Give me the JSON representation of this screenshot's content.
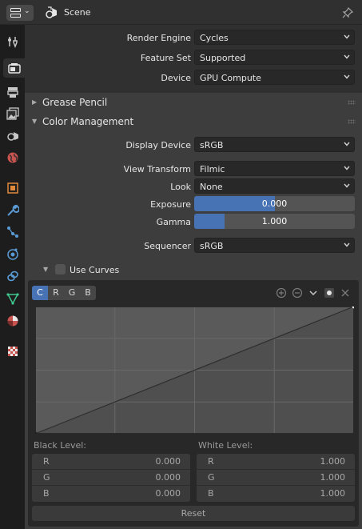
{
  "header": {
    "context_label": "Scene",
    "editor_type_icon": "properties-editor-icon",
    "scene_icon": "scene-icon",
    "pin_icon": "pin-icon"
  },
  "tabs": [
    {
      "name": "tool",
      "icon": "tool-icon"
    },
    {
      "name": "render",
      "icon": "camera-render-icon",
      "active": true
    },
    {
      "name": "output",
      "icon": "printer-output-icon"
    },
    {
      "name": "view-layer",
      "icon": "image-layers-icon"
    },
    {
      "name": "scene",
      "icon": "scene-icon"
    },
    {
      "name": "world",
      "icon": "world-icon"
    },
    {
      "name": "object",
      "icon": "object-icon"
    },
    {
      "name": "modifiers",
      "icon": "wrench-icon"
    },
    {
      "name": "particles",
      "icon": "particles-icon"
    },
    {
      "name": "physics",
      "icon": "physics-icon"
    },
    {
      "name": "constraints",
      "icon": "constraints-icon"
    },
    {
      "name": "data",
      "icon": "mesh-data-icon"
    },
    {
      "name": "material",
      "icon": "material-icon"
    },
    {
      "name": "texture",
      "icon": "texture-icon"
    }
  ],
  "render": {
    "render_engine": {
      "label": "Render Engine",
      "value": "Cycles"
    },
    "feature_set": {
      "label": "Feature Set",
      "value": "Supported"
    },
    "device": {
      "label": "Device",
      "value": "GPU Compute"
    }
  },
  "panels": {
    "grease_pencil": "Grease Pencil",
    "color_management": "Color Management"
  },
  "color_management": {
    "display_device": {
      "label": "Display Device",
      "value": "sRGB"
    },
    "view_transform": {
      "label": "View Transform",
      "value": "Filmic"
    },
    "look": {
      "label": "Look",
      "value": "None"
    },
    "exposure": {
      "label": "Exposure",
      "value": "0.000",
      "fill_fraction": 0.5
    },
    "gamma": {
      "label": "Gamma",
      "value": "1.000",
      "fill_fraction": 0.19
    },
    "sequencer": {
      "label": "Sequencer",
      "value": "sRGB"
    },
    "use_curves": {
      "label": "Use Curves",
      "checked": false
    }
  },
  "curves": {
    "channels": [
      "C",
      "R",
      "G",
      "B"
    ],
    "active_channel": "C",
    "black_level": {
      "label": "Black Level:",
      "rows": [
        {
          "k": "R",
          "v": "0.000"
        },
        {
          "k": "G",
          "v": "0.000"
        },
        {
          "k": "B",
          "v": "0.000"
        }
      ]
    },
    "white_level": {
      "label": "White Level:",
      "rows": [
        {
          "k": "R",
          "v": "1.000"
        },
        {
          "k": "G",
          "v": "1.000"
        },
        {
          "k": "B",
          "v": "1.000"
        }
      ]
    },
    "reset_label": "Reset"
  },
  "colors": {
    "accent": "#4772b3",
    "panel": "#3d3d3d",
    "background": "#303030"
  }
}
